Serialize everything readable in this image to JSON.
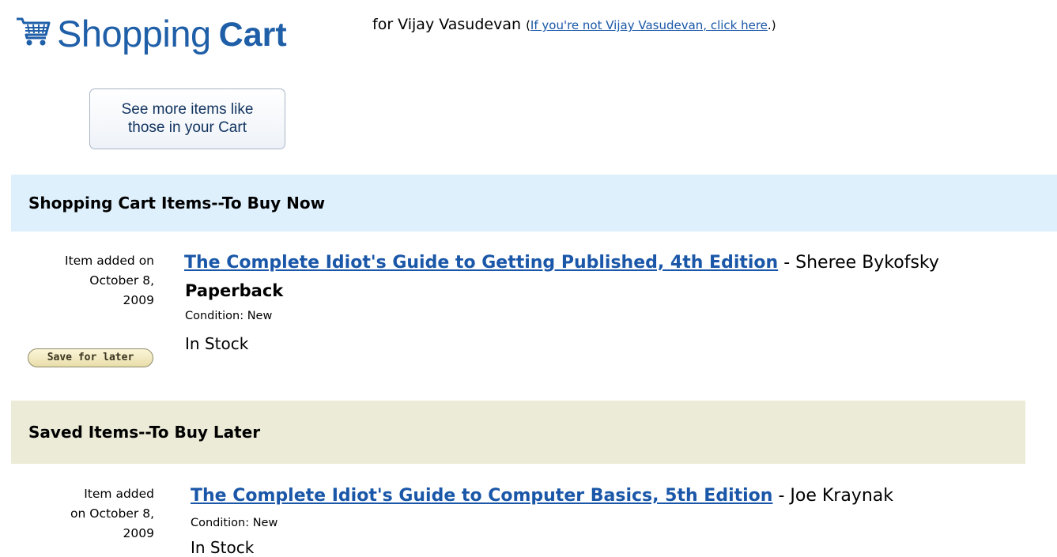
{
  "header": {
    "cart_icon": "shopping-cart-icon",
    "title_light": "Shopping",
    "title_bold": "Cart",
    "for_text": "for Vijay Vasudevan",
    "not_you_open": "(",
    "not_you_link": "If you're not Vijay Vasudevan, click here",
    "not_you_close": ".)",
    "title_color": "#1f5fa8"
  },
  "see_more_button": {
    "line1": "See more items like",
    "line2": "those in your Cart"
  },
  "cart_section": {
    "heading": "Shopping Cart Items--To Buy Now",
    "background": "#def0fc",
    "items": [
      {
        "added_line1": "Item added on",
        "added_line2": "October 8,",
        "added_line3": "2009",
        "title": "The Complete Idiot's Guide to Getting Published, 4th Edition",
        "author": " - Sheree Bykofsky",
        "format": "Paperback",
        "condition": "Condition: New",
        "stock": "In Stock",
        "save_button": "Save for later"
      }
    ]
  },
  "saved_section": {
    "heading": "Saved Items--To Buy Later",
    "background": "#ecebd7",
    "items": [
      {
        "added_line1": "Item added",
        "added_line2": "on October 8,",
        "added_line3": "2009",
        "title": "The Complete Idiot's Guide to Computer Basics, 5th Edition",
        "author": " - Joe Kraynak",
        "condition": "Condition: New",
        "stock": "In Stock"
      }
    ]
  }
}
